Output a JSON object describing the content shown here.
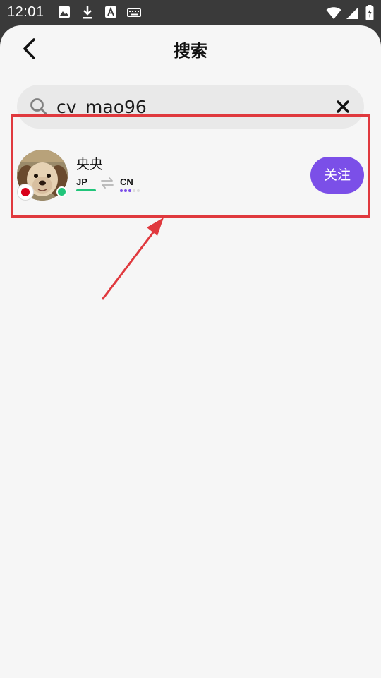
{
  "status_bar": {
    "time": "12:01",
    "icons": [
      "image-icon",
      "download-icon",
      "a-icon",
      "keyboard-icon"
    ],
    "right_icons": [
      "wifi-icon",
      "signal-icon",
      "battery-icon"
    ]
  },
  "header": {
    "title": "搜索",
    "back_icon": "back-arrow-icon"
  },
  "search": {
    "value": "cv_mao96",
    "search_icon": "search-icon",
    "clear_icon": "close-icon"
  },
  "result": {
    "name": "央央",
    "native_lang": "JP",
    "learning_lang": "CN",
    "learning_level": 0.6,
    "online": true,
    "flag": "japan-flag",
    "follow_label": "关注"
  },
  "colors": {
    "accent": "#7b4fe8",
    "online": "#21c57a",
    "highlight": "#e0393e",
    "background": "#f6f6f6"
  }
}
